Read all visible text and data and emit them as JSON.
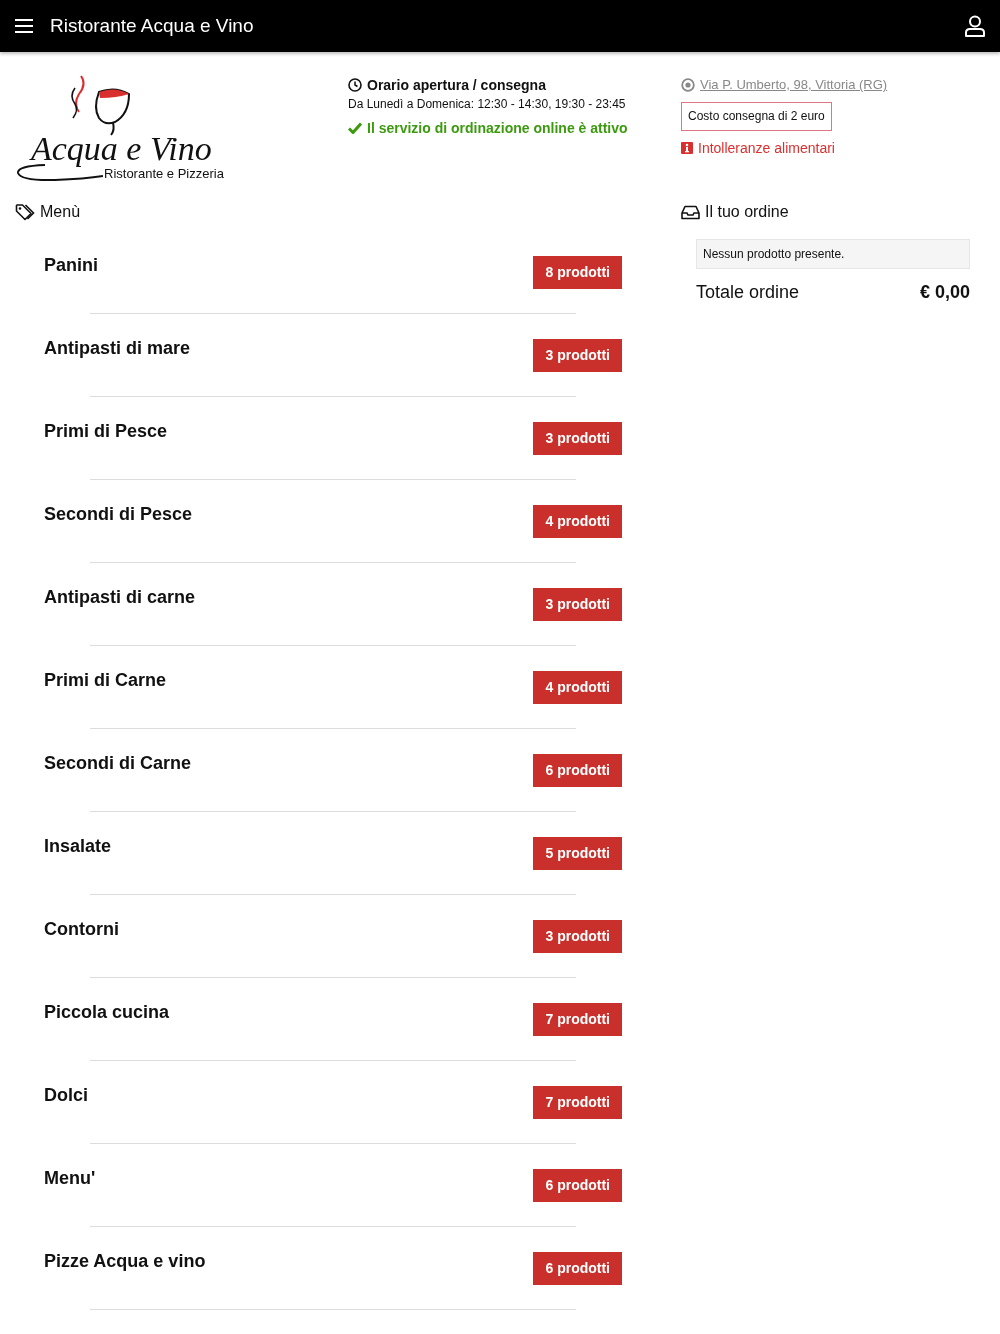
{
  "header": {
    "title": "Ristorante Acqua e Vino"
  },
  "logo": {
    "name": "Acqua e Vino",
    "tagline": "Ristorante e Pizzeria"
  },
  "hours": {
    "title": "Orario apertura / consegna",
    "schedule": "Da Lunedì a Domenica: 12:30 - 14:30, 19:30 - 23:45",
    "status": "Il servizio di ordinazione online è attivo",
    "active": true
  },
  "contact": {
    "address": "Via P. Umberto, 98, Vittoria (RG)",
    "delivery_fee": "Costo consegna di 2 euro",
    "allergens_link": "Intolleranze alimentari"
  },
  "menu": {
    "title": "Menù",
    "categories": [
      {
        "name": "Panini",
        "count": "8 prodotti"
      },
      {
        "name": "Antipasti di mare",
        "count": "3 prodotti"
      },
      {
        "name": "Primi di Pesce",
        "count": "3 prodotti"
      },
      {
        "name": "Secondi di Pesce",
        "count": "4 prodotti"
      },
      {
        "name": "Antipasti di carne",
        "count": "3 prodotti"
      },
      {
        "name": "Primi di Carne",
        "count": "4 prodotti"
      },
      {
        "name": "Secondi di Carne",
        "count": "6 prodotti"
      },
      {
        "name": "Insalate",
        "count": "5 prodotti"
      },
      {
        "name": "Contorni",
        "count": "3 prodotti"
      },
      {
        "name": "Piccola cucina",
        "count": "7 prodotti"
      },
      {
        "name": "Dolci",
        "count": "7 prodotti"
      },
      {
        "name": "Menu'",
        "count": "6 prodotti"
      },
      {
        "name": "Pizze Acqua e vino",
        "count": "6 prodotti"
      }
    ]
  },
  "order": {
    "title": "Il tuo ordine",
    "empty_message": "Nessun prodotto presente.",
    "total_label": "Totale ordine",
    "total_value": "€ 0,00"
  }
}
